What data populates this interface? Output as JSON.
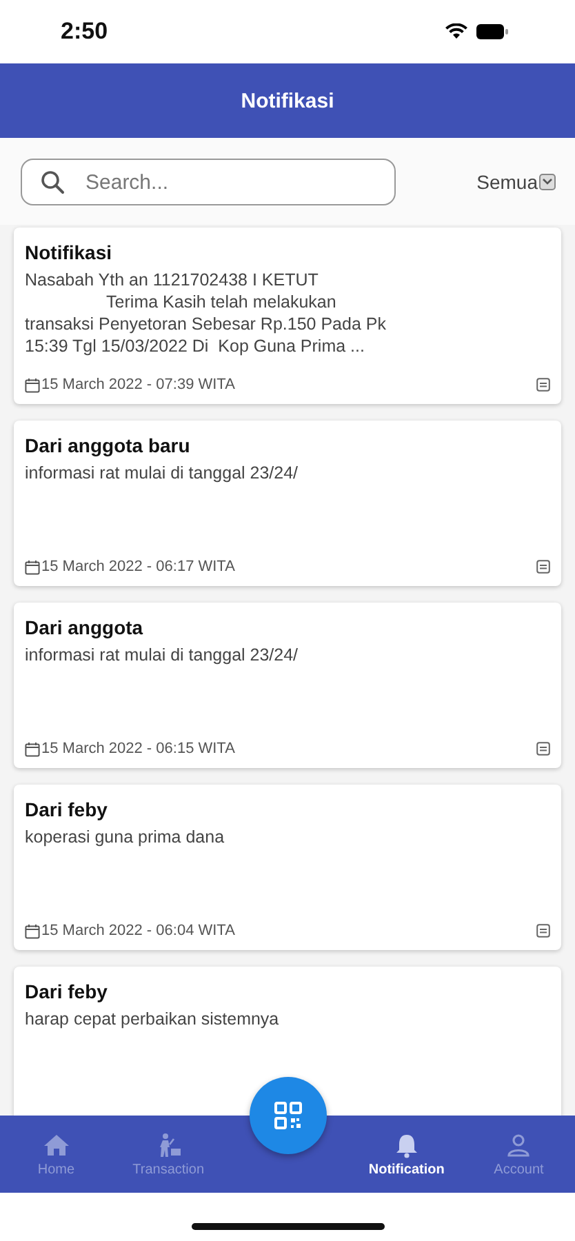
{
  "status_bar": {
    "time": "2:50"
  },
  "header": {
    "title": "Notifikasi"
  },
  "search": {
    "placeholder": "Search..."
  },
  "filter": {
    "label": "Semua"
  },
  "notifications": [
    {
      "title": "Notifikasi",
      "body": "Nasabah Yth an 1121702438 I KETUT\n                 Terima Kasih telah melakukan\ntransaksi Penyetoran Sebesar Rp.150 Pada Pk\n15:39 Tgl 15/03/2022 Di  Kop Guna Prima ...",
      "date": "15 March 2022 - 07:39 WITA"
    },
    {
      "title": "Dari anggota baru",
      "body": "informasi rat mulai di tanggal 23/24/",
      "date": "15 March 2022 - 06:17 WITA"
    },
    {
      "title": "Dari anggota",
      "body": "informasi rat mulai di tanggal 23/24/",
      "date": "15 March 2022 - 06:15 WITA"
    },
    {
      "title": "Dari feby",
      "body": "koperasi guna prima dana",
      "date": "15 March 2022 - 06:04 WITA"
    },
    {
      "title": "Dari feby",
      "body": "harap cepat perbaikan sistemnya"
    }
  ],
  "bottom_nav": [
    {
      "label": "Home",
      "kind": "home",
      "selected": false
    },
    {
      "label": "Transaction",
      "kind": "transaction",
      "selected": false
    },
    {
      "kind": "scan"
    },
    {
      "label": "Notification",
      "kind": "notification",
      "selected": true
    },
    {
      "label": "Account",
      "kind": "account",
      "selected": false
    }
  ]
}
